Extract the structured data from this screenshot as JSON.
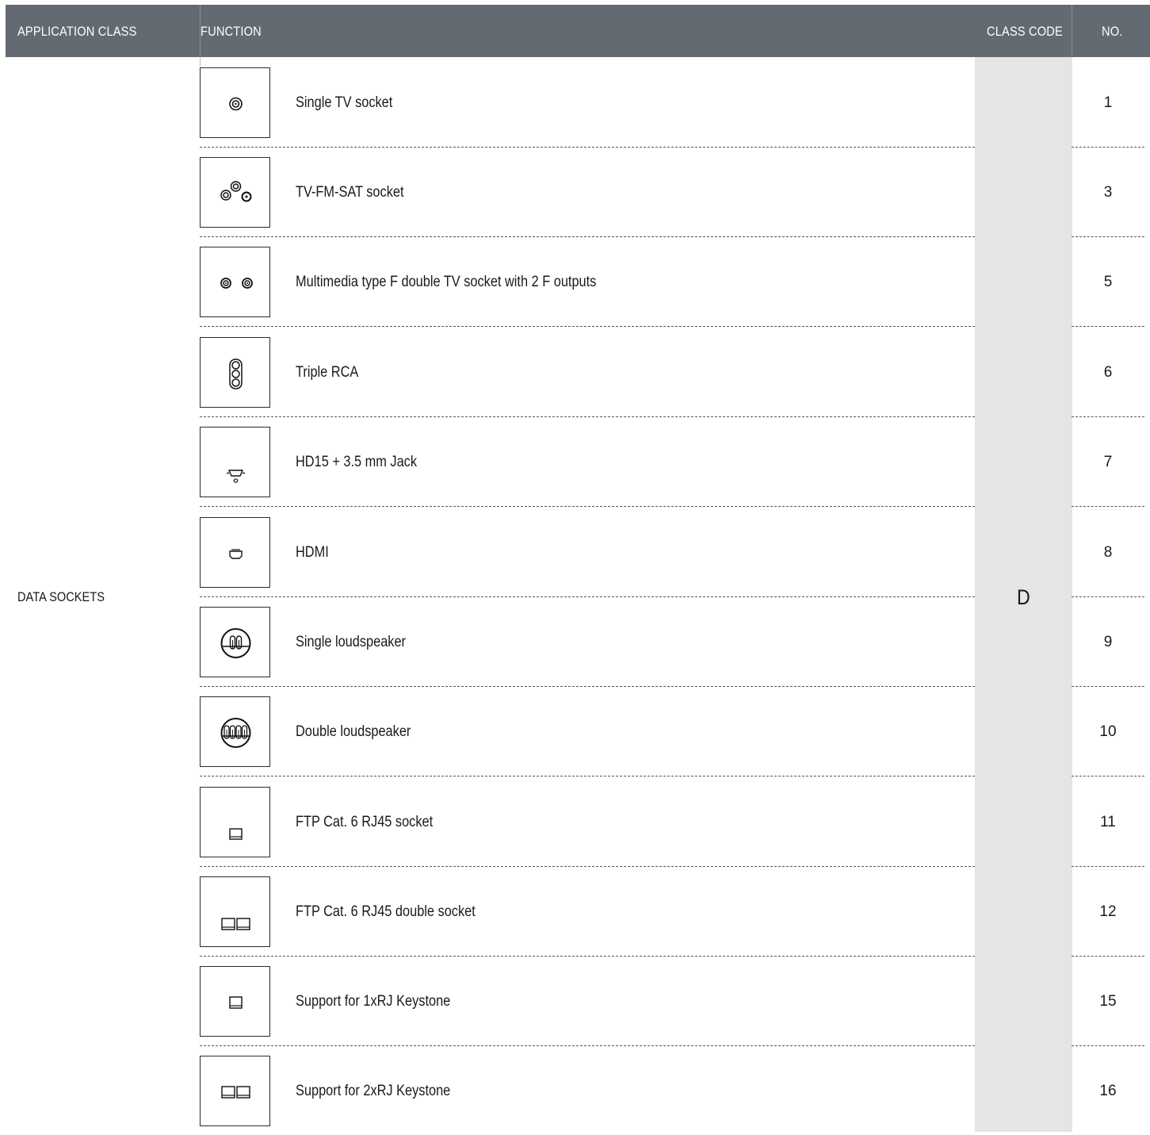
{
  "header": {
    "application_class": "APPLICATION CLASS",
    "function": "FUNCTION",
    "class_code": "CLASS CODE",
    "no": "NO."
  },
  "application_class": "DATA SOCKETS",
  "class_code": "D",
  "rows": [
    {
      "icon": "single-tv-socket-icon",
      "label": "Single TV socket",
      "no": "1"
    },
    {
      "icon": "tv-fm-sat-socket-icon",
      "label": "TV-FM-SAT socket",
      "no": "3"
    },
    {
      "icon": "double-f-tv-socket-icon",
      "label": "Multimedia type F double TV socket with 2 F outputs",
      "no": "5"
    },
    {
      "icon": "triple-rca-icon",
      "label": "Triple RCA",
      "no": "6"
    },
    {
      "icon": "hd15-jack-icon",
      "label": "HD15 + 3.5 mm Jack",
      "no": "7"
    },
    {
      "icon": "hdmi-icon",
      "label": "HDMI",
      "no": "8"
    },
    {
      "icon": "single-loudspeaker-icon",
      "label": "Single loudspeaker",
      "no": "9"
    },
    {
      "icon": "double-loudspeaker-icon",
      "label": "Double loudspeaker",
      "no": "10"
    },
    {
      "icon": "rj45-socket-icon",
      "label": "FTP Cat. 6 RJ45 socket",
      "no": "11"
    },
    {
      "icon": "rj45-double-socket-icon",
      "label": "FTP Cat. 6 RJ45 double socket",
      "no": "12"
    },
    {
      "icon": "keystone-1xrj-icon",
      "label": "Support for 1xRJ Keystone",
      "no": "15"
    },
    {
      "icon": "keystone-2xrj-icon",
      "label": "Support for 2xRJ Keystone",
      "no": "16"
    }
  ]
}
